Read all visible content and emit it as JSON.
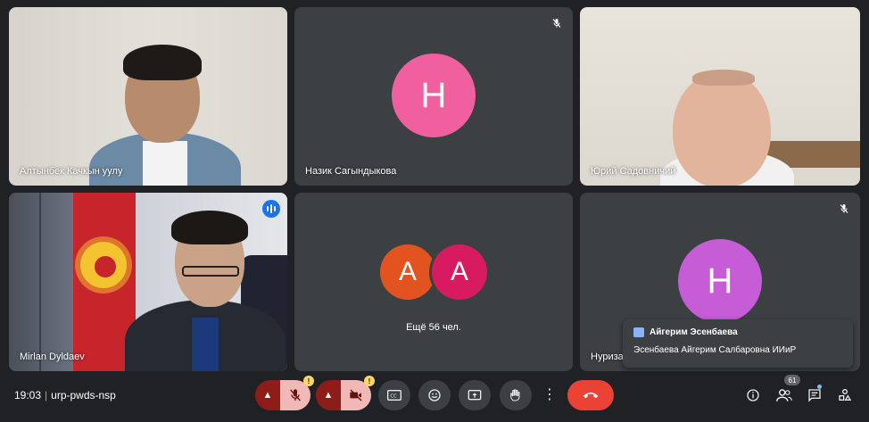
{
  "tiles": [
    {
      "name": "Алтынбек Качкын уулу",
      "type": "video"
    },
    {
      "name": "Назик Сагындыкова",
      "type": "avatar",
      "initial": "Н",
      "muted": true
    },
    {
      "name": "Юрий Садовничий",
      "type": "video"
    },
    {
      "name": "Mirlan Dyldaev",
      "type": "video",
      "speaking": true
    },
    {
      "type": "group",
      "initials": [
        "A",
        "A"
      ],
      "more": "Ещё 56 чел."
    },
    {
      "name": "Нуриза",
      "type": "avatar",
      "initial": "Н",
      "muted": true
    }
  ],
  "chat_popup": {
    "sender": "Айгерим Эсенбаева",
    "message": "Эсенбаева Айгерим Салбаровна ИИиР"
  },
  "bottom_bar": {
    "time": "19:03",
    "separator": "|",
    "meeting_code": "urp-pwds-nsp",
    "participants_count": "61"
  },
  "colors": {
    "background": "#202124",
    "tile": "#3c4043",
    "avatar_pink": "#f0609e",
    "avatar_orange": "#e3531f",
    "avatar_magenta": "#d81b60",
    "avatar_purple": "#c65cd6",
    "hangup": "#ea4335",
    "active_border": "#8ab4f8"
  },
  "icons": {
    "mic": "mic-off-icon",
    "camera": "camera-off-icon",
    "captions": "closed-captions-icon",
    "emoji": "emoji-icon",
    "present": "present-screen-icon",
    "raise_hand": "raise-hand-icon",
    "more": "more-options-icon",
    "hangup": "hang-up-icon",
    "info": "meeting-info-icon",
    "people": "people-icon",
    "chat": "chat-icon",
    "activities": "activities-icon"
  }
}
